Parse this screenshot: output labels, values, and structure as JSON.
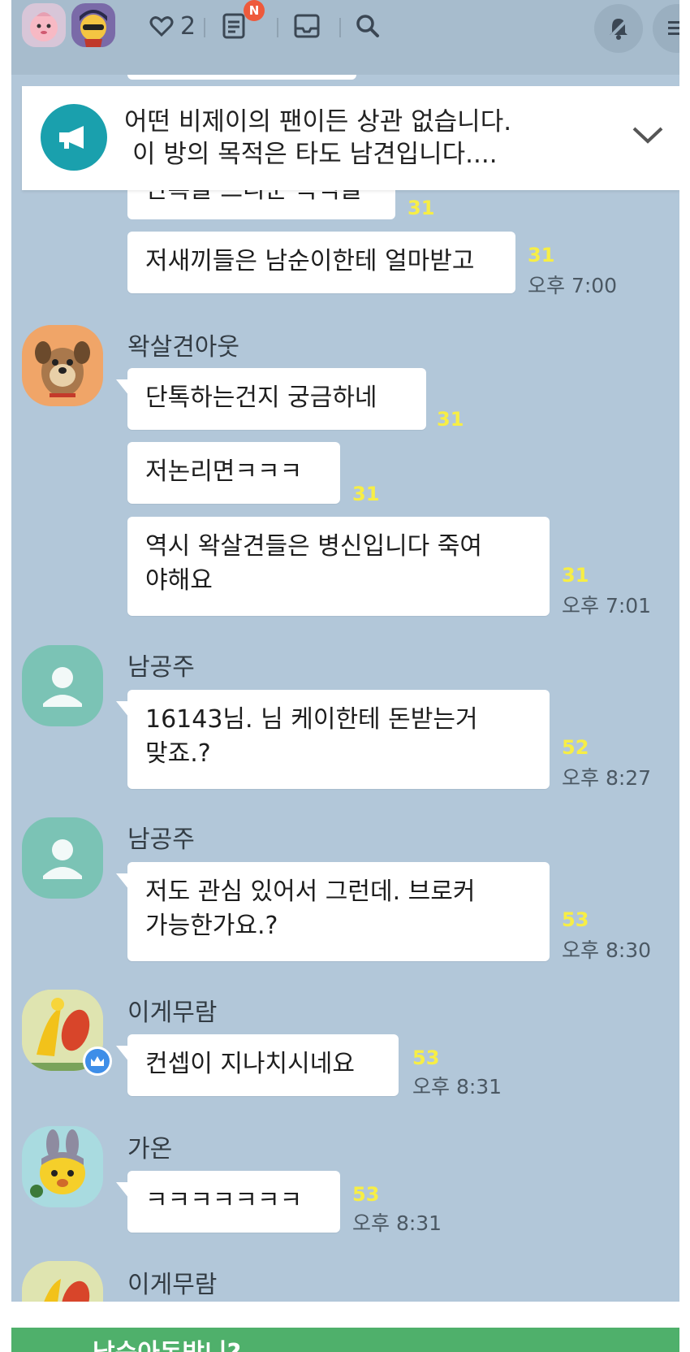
{
  "topbar": {
    "likes_count": "2",
    "notes_badge": "N"
  },
  "notice": {
    "line1": "어떤 비제이의 팬이든 상관 없습니다.",
    "line2": "이 방의 목적은 타도 남견입니다...."
  },
  "partial_top": {
    "bubble_text": "단톡을 드리운 목적을",
    "unread": "31"
  },
  "messages": [
    {
      "text": "저새끼들은 남순이한테 얼마받고",
      "unread": "31",
      "time": "오후 7:00"
    },
    {
      "nick": "왁살견아웃",
      "text": "단톡하는건지 궁금하네",
      "unread": "31"
    },
    {
      "text": "저논리면ㅋㅋㅋ",
      "unread": "31"
    },
    {
      "line1": "역시 왁살견들은 병신입니다 죽여",
      "line2": "야해요",
      "unread": "31",
      "time": "오후 7:01"
    },
    {
      "nick": "남공주",
      "line1": "16143님. 님 케이한테 돈받는거",
      "line2": "맞죠.?",
      "unread": "52",
      "time": "오후 8:27"
    },
    {
      "nick": "남공주",
      "line1": "저도 관심 있어서 그런데. 브로커",
      "line2": "가능한가요.?",
      "unread": "53",
      "time": "오후 8:30"
    },
    {
      "nick": "이게무람",
      "text": "컨셉이 지나치시네요",
      "unread": "53",
      "time": "오후 8:31"
    },
    {
      "nick": "가온",
      "text": "ㅋㅋㅋㅋㅋㅋㅋ",
      "unread": "53",
      "time": "오후 8:31"
    },
    {
      "nick": "이게무람"
    }
  ],
  "bottom": {
    "text": "남순아돈받니?"
  }
}
